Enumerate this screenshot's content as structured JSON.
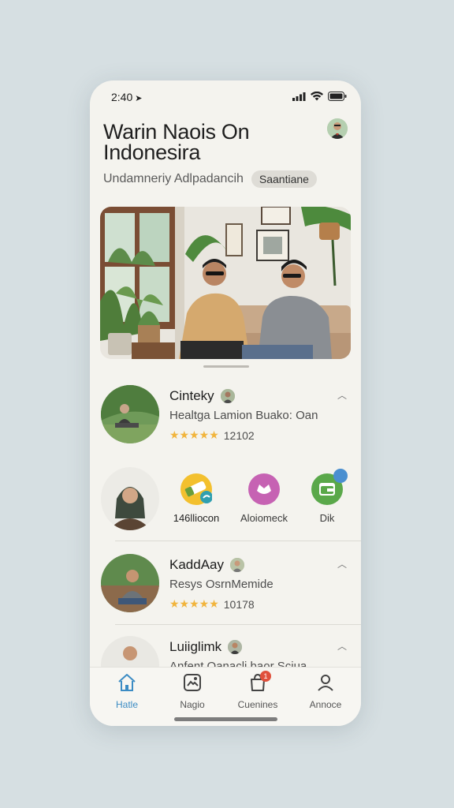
{
  "status_bar": {
    "time": "2:40"
  },
  "header": {
    "title": "Warin Naois On Indonesira",
    "subtitle": "Undamneriy Adlpadancih",
    "chip": "Saantiane"
  },
  "feed": {
    "cards": [
      {
        "name": "Cinteky",
        "description": "Healtga Lamion Buako: Oan",
        "stars": "★★★★★",
        "count": "12102"
      },
      {
        "name": "KaddAay",
        "description": "Resys OsrnMemide",
        "stars": "★★★★★",
        "count": "10178"
      },
      {
        "name": "Luiiglimk",
        "description": "Anfent Oanacli baor Sciua"
      }
    ],
    "apps": [
      {
        "label": "146lliocon",
        "icon": "sticker-icon",
        "color": "#f3c02e"
      },
      {
        "label": "Aloiomeck",
        "icon": "crown-icon",
        "color": "#c662b3"
      },
      {
        "label": "Dik",
        "icon": "wallet-icon",
        "color": "#5aa84a"
      }
    ]
  },
  "tabbar": {
    "tabs": [
      {
        "label": "Hatle",
        "icon": "home-icon",
        "active": true
      },
      {
        "label": "Nagio",
        "icon": "gallery-icon"
      },
      {
        "label": "Cuenines",
        "icon": "bag-icon",
        "badge": "1"
      },
      {
        "label": "Annoce",
        "icon": "person-icon"
      }
    ]
  },
  "colors": {
    "accent": "#3c8cc4",
    "star": "#f1b43c",
    "background": "#f4f3ee"
  }
}
